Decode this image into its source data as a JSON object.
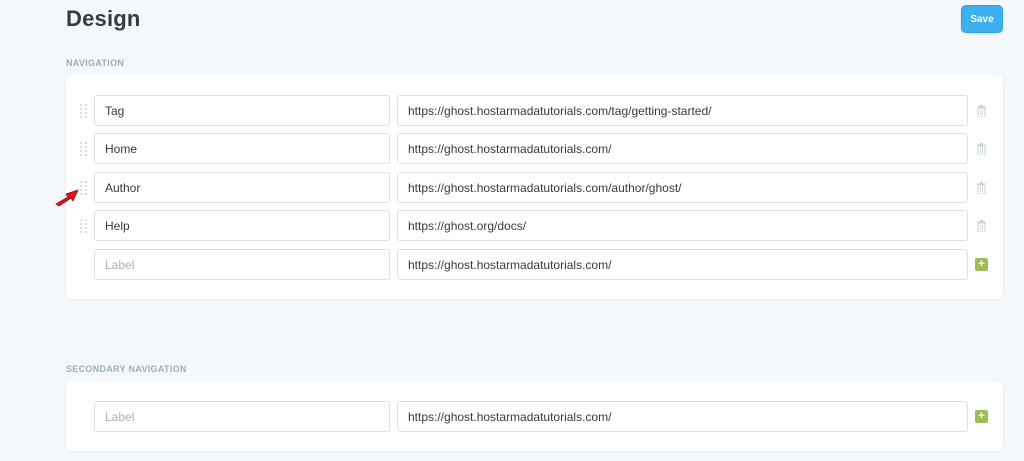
{
  "page": {
    "title": "Design"
  },
  "toolbar": {
    "save_label": "Save"
  },
  "navigation": {
    "section_label": "NAVIGATION",
    "items": [
      {
        "label": "Tag",
        "url": "https://ghost.hostarmadatutorials.com/tag/getting-started/"
      },
      {
        "label": "Home",
        "url": "https://ghost.hostarmadatutorials.com/"
      },
      {
        "label": "Author",
        "url": "https://ghost.hostarmadatutorials.com/author/ghost/"
      },
      {
        "label": "Help",
        "url": "https://ghost.org/docs/"
      }
    ],
    "new_item": {
      "label_placeholder": "Label",
      "url": "https://ghost.hostarmadatutorials.com/"
    }
  },
  "secondary_navigation": {
    "section_label": "SECONDARY NAVIGATION",
    "new_item": {
      "label_placeholder": "Label",
      "url": "https://ghost.hostarmadatutorials.com/"
    }
  },
  "icons": {
    "drag": "drag-handle-icon",
    "delete": "trash-icon",
    "add": "plus-icon",
    "annotation": "red-arrow-icon"
  },
  "colors": {
    "accent": "#3eb0ef",
    "add_button": "#9fbb58",
    "annotation_arrow": "#d9141a",
    "page_background": "#f4f8fb"
  },
  "add_symbol": "+"
}
